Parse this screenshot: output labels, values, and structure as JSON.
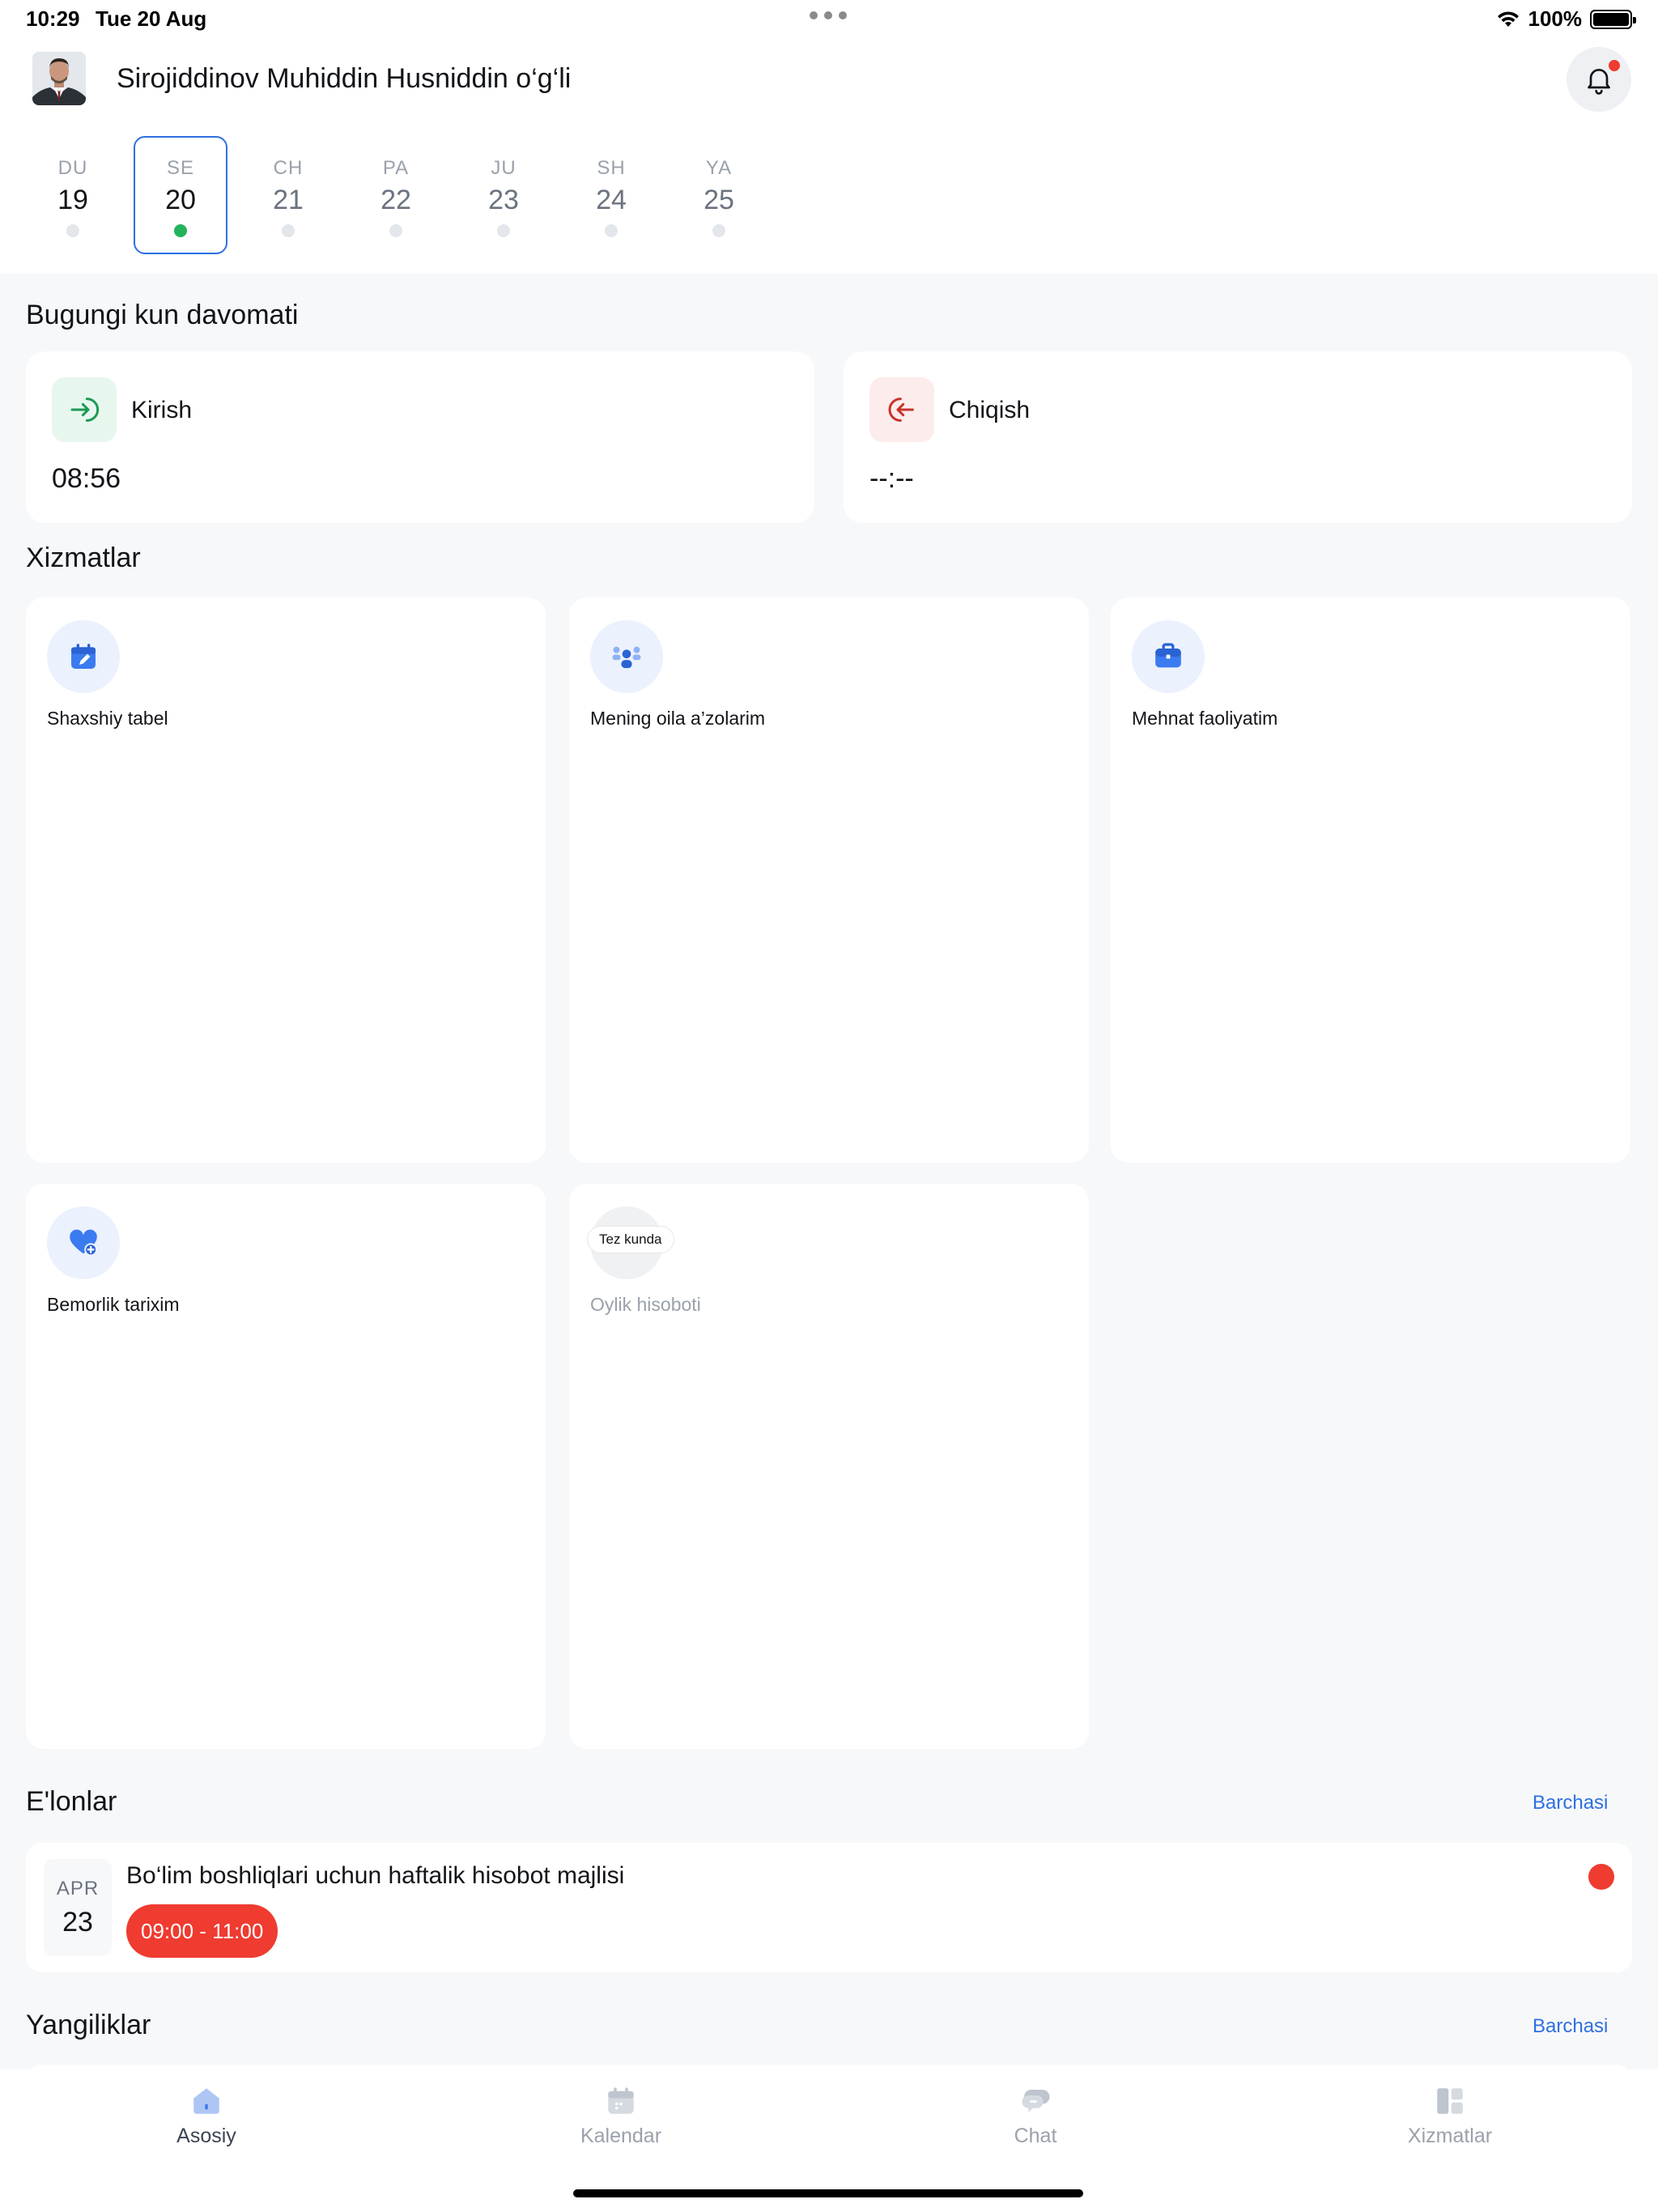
{
  "status_bar": {
    "time": "10:29",
    "date": "Tue 20 Aug",
    "battery": "100%"
  },
  "header": {
    "user_name": "Sirojiddinov Muhiddin Husniddin o‘g‘li",
    "has_notification": true
  },
  "week": [
    {
      "label": "DU",
      "num": "19"
    },
    {
      "label": "SE",
      "num": "20",
      "selected": true
    },
    {
      "label": "CH",
      "num": "21"
    },
    {
      "label": "PA",
      "num": "22"
    },
    {
      "label": "JU",
      "num": "23"
    },
    {
      "label": "SH",
      "num": "24"
    },
    {
      "label": "YA",
      "num": "25"
    }
  ],
  "attendance": {
    "title": "Bugungi kun davomati",
    "checkin": {
      "label": "Kirish",
      "time": "08:56",
      "icon": "login-arrow-icon",
      "color": "#1e9a55"
    },
    "checkout": {
      "label": "Chiqish",
      "time": "--:--",
      "icon": "logout-arrow-icon",
      "color": "#c8332b"
    }
  },
  "services": {
    "title": "Xizmatlar",
    "items": [
      {
        "label": "Shaxshiy tabel",
        "icon": "calendar-edit-icon"
      },
      {
        "label": "Mening oila a’zolarim",
        "icon": "family-icon"
      },
      {
        "label": "Mehnat faoliyatim",
        "icon": "briefcase-icon"
      },
      {
        "label": "Bemorlik tarixim",
        "icon": "heart-plus-icon"
      },
      {
        "label": "Oylik hisoboti",
        "badge": "Tez kunda",
        "disabled": true
      }
    ]
  },
  "announcements": {
    "title": "E'lonlar",
    "see_all": "Barchasi",
    "items": [
      {
        "month": "APR",
        "day": "23",
        "title": "Bo‘lim boshliqlari uchun haftalik hisobot majlisi",
        "time": "09:00 - 11:00"
      }
    ]
  },
  "news": {
    "title": "Yangiliklar",
    "see_all": "Barchasi"
  },
  "tabbar": {
    "items": [
      {
        "label": "Asosiy",
        "icon": "home-icon",
        "active": true
      },
      {
        "label": "Kalendar",
        "icon": "calendar-icon"
      },
      {
        "label": "Chat",
        "icon": "chat-icon"
      },
      {
        "label": "Xizmatlar",
        "icon": "grid-icon"
      }
    ]
  },
  "colors": {
    "accent": "#2e6fe0",
    "success": "#22b45a",
    "danger": "#ef3b30"
  }
}
